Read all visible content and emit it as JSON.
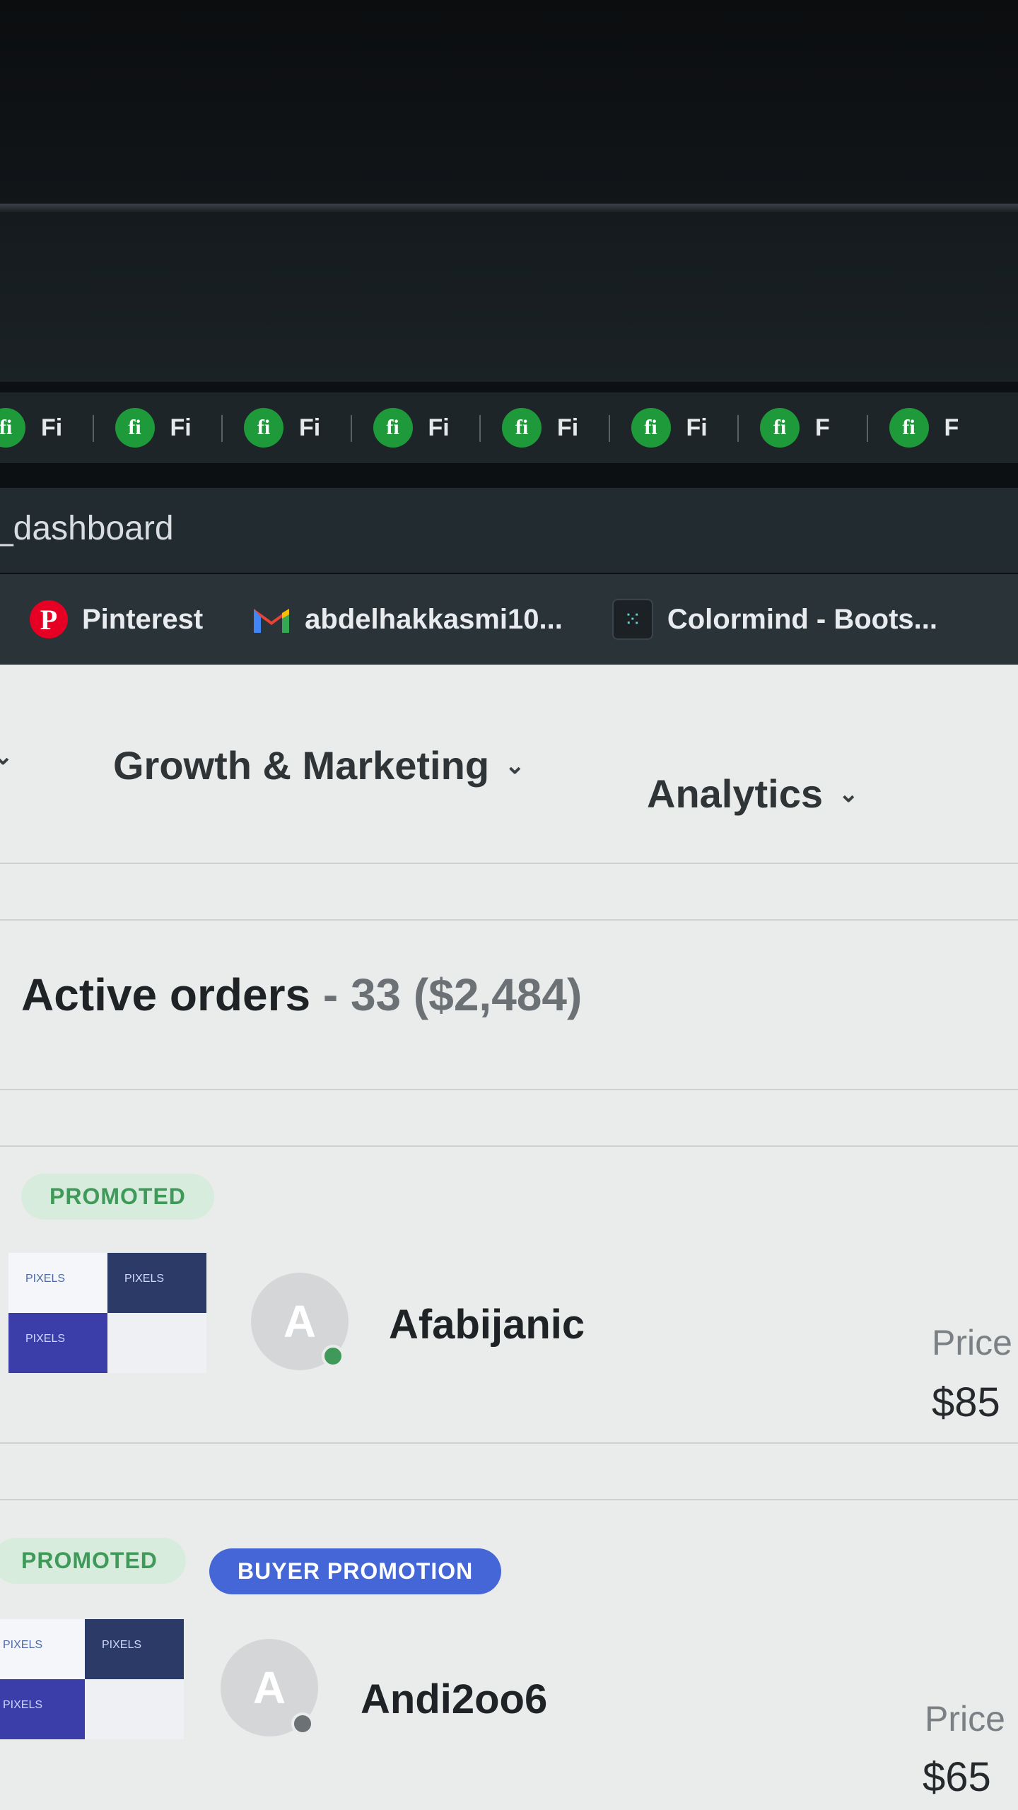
{
  "tabs": [
    {
      "icon": "fi",
      "label": "Fi"
    },
    {
      "icon": "fi",
      "label": "Fi"
    },
    {
      "icon": "fi",
      "label": "Fi"
    },
    {
      "icon": "fi",
      "label": "Fi"
    },
    {
      "icon": "fi",
      "label": "Fi"
    },
    {
      "icon": "fi",
      "label": "Fi"
    },
    {
      "icon": "fi",
      "label": "F"
    },
    {
      "icon": "fi",
      "label": "F"
    }
  ],
  "address": {
    "text": "r_dashboard"
  },
  "bookmarks": [
    {
      "icon": "pinterest-icon",
      "label": "Pinterest"
    },
    {
      "icon": "gmail-icon",
      "label": "abdelhakkasmi10..."
    },
    {
      "icon": "colormind-icon",
      "label": "Colormind - Boots..."
    }
  ],
  "nav": {
    "growth": "Growth & Marketing",
    "analytics": "Analytics"
  },
  "section": {
    "title": "Active orders",
    "count": " - 33 ($2,484)"
  },
  "orders": [
    {
      "badges": [
        "PROMOTED"
      ],
      "avatar_letter": "A",
      "username": "Afabijanic",
      "online": true,
      "price_label": "Price",
      "price": "$85",
      "thumb_logo": "PIXELS"
    },
    {
      "badges": [
        "PROMOTED",
        "BUYER PROMOTION"
      ],
      "avatar_letter": "A",
      "username": "Andi2oo6",
      "online": false,
      "price_label": "Price",
      "price": "$65",
      "thumb_logo": "PIXELS"
    }
  ],
  "colors": {
    "fiverr_green": "#1f9a3a",
    "promoted_bg": "#d8ecde",
    "promoted_text": "#3f9a5a",
    "buyer_promotion_bg": "#4566d6",
    "online_dot": "#3f9a5a",
    "offline_dot": "#6b7174"
  }
}
